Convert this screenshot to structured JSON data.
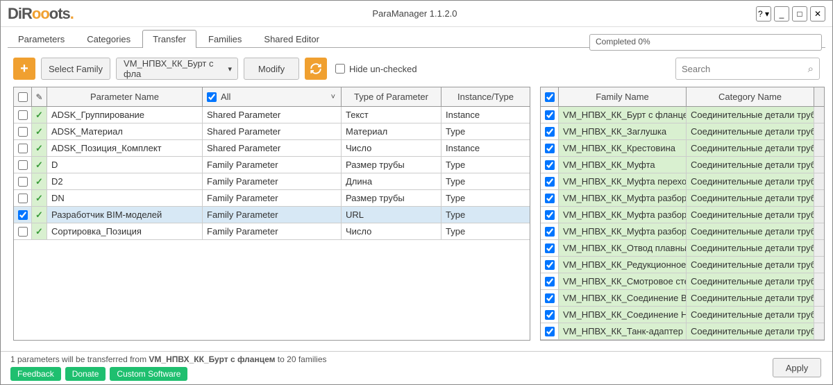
{
  "title": "ParaManager 1.1.2.0",
  "logo": {
    "pre": "DiR",
    "o": "o",
    "post": "ots",
    "dot": "."
  },
  "window_buttons": {
    "help": "? ▾",
    "min": "_",
    "max": "□",
    "close": "✕"
  },
  "status": "Completed 0%",
  "tabs": [
    "Parameters",
    "Categories",
    "Transfer",
    "Families",
    "Shared Editor"
  ],
  "active_tab": 2,
  "toolbar": {
    "select_family": "Select Family",
    "family_dropdown": "VM_НПВХ_КК_Бурт с фла",
    "modify": "Modify",
    "hide_unchecked": "Hide un-checked",
    "search_placeholder": "Search"
  },
  "left_headers": {
    "parameter_name": "Parameter Name",
    "all": "All",
    "type_of_parameter": "Type of Parameter",
    "instance_type": "Instance/Type",
    "edit_symbol": "✎"
  },
  "right_headers": {
    "family_name": "Family Name",
    "category_name": "Category Name"
  },
  "left_rows": [
    {
      "name": "ADSK_Группирование",
      "kind": "Shared Parameter",
      "type": "Текст",
      "inst": "Instance",
      "sel": false
    },
    {
      "name": "ADSK_Материал",
      "kind": "Shared Parameter",
      "type": "Материал",
      "inst": "Type",
      "sel": false
    },
    {
      "name": "ADSK_Позиция_Комплект",
      "kind": "Shared Parameter",
      "type": "Число",
      "inst": "Instance",
      "sel": false
    },
    {
      "name": "D",
      "kind": "Family Parameter",
      "type": "Размер трубы",
      "inst": "Type",
      "sel": false
    },
    {
      "name": "D2",
      "kind": "Family Parameter",
      "type": "Длина",
      "inst": "Type",
      "sel": false
    },
    {
      "name": "DN",
      "kind": "Family Parameter",
      "type": "Размер трубы",
      "inst": "Type",
      "sel": false
    },
    {
      "name": "Разработчик BIM-моделей",
      "kind": "Family Parameter",
      "type": "URL",
      "inst": "Type",
      "sel": true
    },
    {
      "name": "Сортировка_Позиция",
      "kind": "Family Parameter",
      "type": "Число",
      "inst": "Type",
      "sel": false
    }
  ],
  "right_rows": [
    {
      "fname": "VM_НПВХ_КК_Бурт с фланцем",
      "cname": "Соединительные детали трубопр"
    },
    {
      "fname": "VM_НПВХ_КК_Заглушка",
      "cname": "Соединительные детали трубопр"
    },
    {
      "fname": "VM_НПВХ_КК_Крестовина",
      "cname": "Соединительные детали трубопр"
    },
    {
      "fname": "VM_НПВХ_КК_Муфта",
      "cname": "Соединительные детали трубопр"
    },
    {
      "fname": "VM_НПВХ_КК_Муфта переходная",
      "cname": "Соединительные детали трубопр"
    },
    {
      "fname": "VM_НПВХ_КК_Муфта разборная",
      "cname": "Соединительные детали трубопр"
    },
    {
      "fname": "VM_НПВХ_КК_Муфта разборная п",
      "cname": "Соединительные детали трубопр"
    },
    {
      "fname": "VM_НПВХ_КК_Муфта разборная п",
      "cname": "Соединительные детали трубопр"
    },
    {
      "fname": "VM_НПВХ_КК_Отвод плавный",
      "cname": "Соединительные детали трубопр"
    },
    {
      "fname": "VM_НПВХ_КК_Редукционное кол",
      "cname": "Соединительные детали трубопр"
    },
    {
      "fname": "VM_НПВХ_КК_Смотровое стекло",
      "cname": "Соединительные детали трубопр"
    },
    {
      "fname": "VM_НПВХ_КК_Соединение ВР",
      "cname": "Соединительные детали трубопр"
    },
    {
      "fname": "VM_НПВХ_КК_Соединение НР",
      "cname": "Соединительные детали трубопр"
    },
    {
      "fname": "VM_НПВХ_КК_Танк-адаптер",
      "cname": "Соединительные детали трубопр"
    }
  ],
  "footer": {
    "prefix": "1 parameters will be transferred from ",
    "bold": "VM_НПВХ_КК_Бурт с фланцем",
    "suffix": " to 20 families",
    "feedback": "Feedback",
    "donate": "Donate",
    "custom": "Custom Software",
    "apply": "Apply"
  }
}
